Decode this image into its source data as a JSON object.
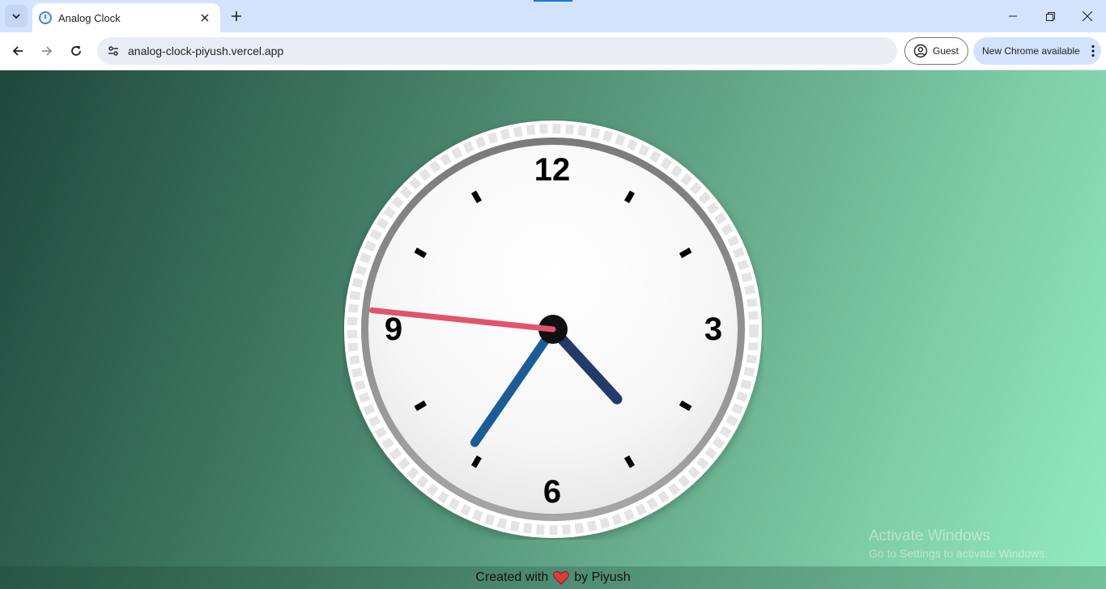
{
  "browser": {
    "tab_title": "Analog Clock",
    "url": "analog-clock-piyush.vercel.app",
    "profile_label": "Guest",
    "update_label": "New Chrome available"
  },
  "clock": {
    "numerals": {
      "twelve": "12",
      "three": "3",
      "six": "6",
      "nine": "9"
    },
    "time": {
      "hours": 4,
      "minutes": 35,
      "seconds": 46
    },
    "colors": {
      "hour_hand": "#243a6b",
      "minute_hand": "#1a5d96",
      "second_hand": "#e0546e"
    }
  },
  "footer": {
    "before": "Created with",
    "after": "by Piyush"
  },
  "watermark": {
    "line1": "Activate Windows",
    "line2": "Go to Settings to activate Windows."
  }
}
